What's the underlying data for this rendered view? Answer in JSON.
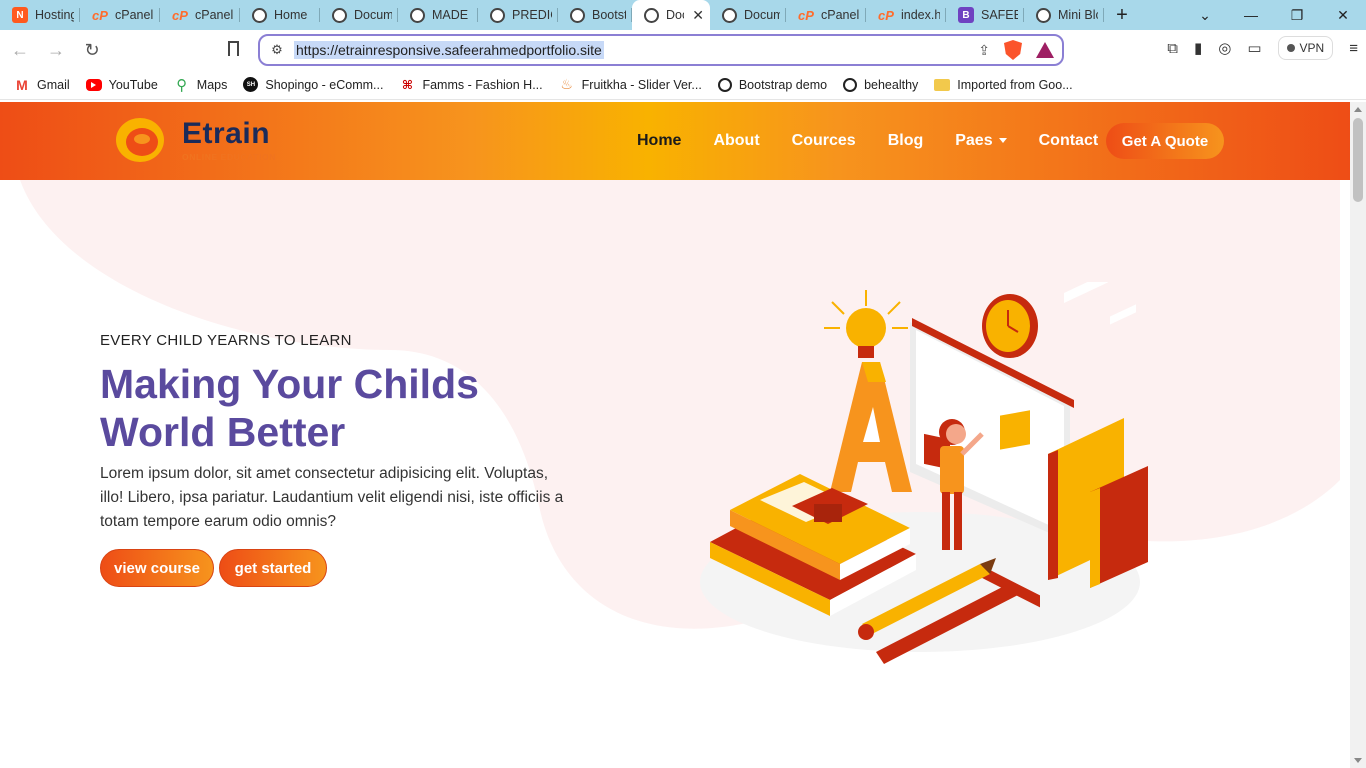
{
  "tabs": [
    {
      "title": "Hosting",
      "icon": "hosting-icon"
    },
    {
      "title": "cPanel -",
      "icon": "cpanel-icon"
    },
    {
      "title": "cPanel -",
      "icon": "cpanel-icon"
    },
    {
      "title": "Home",
      "icon": "globe-icon"
    },
    {
      "title": "Docume",
      "icon": "globe-icon"
    },
    {
      "title": "MADE B",
      "icon": "globe-icon"
    },
    {
      "title": "PREDIC",
      "icon": "globe-icon"
    },
    {
      "title": "Bootstra",
      "icon": "globe-icon"
    },
    {
      "title": "Doc",
      "icon": "globe-icon",
      "active": true
    },
    {
      "title": "Docume",
      "icon": "globe-icon"
    },
    {
      "title": "cPanel F",
      "icon": "cpanel-icon"
    },
    {
      "title": "index.ht",
      "icon": "cpanel-icon"
    },
    {
      "title": "SAFEER",
      "icon": "bootstrap-icon"
    },
    {
      "title": "Mini Blc",
      "icon": "globe-icon"
    }
  ],
  "address": {
    "url": "https://etrainresponsive.safeerahmedportfolio.site"
  },
  "toolbar": {
    "vpn_label": "VPN"
  },
  "bookmarks": [
    {
      "label": "Gmail",
      "icon": "gmail-icon"
    },
    {
      "label": "YouTube",
      "icon": "youtube-icon"
    },
    {
      "label": "Maps",
      "icon": "maps-icon"
    },
    {
      "label": "Shopingo - eComm...",
      "icon": "sh-icon"
    },
    {
      "label": "Famms - Fashion H...",
      "icon": "famms-icon"
    },
    {
      "label": "Fruitkha - Slider Ver...",
      "icon": "fruitkha-icon"
    },
    {
      "label": "Bootstrap demo",
      "icon": "globe-icon"
    },
    {
      "label": "behealthy",
      "icon": "globe-icon"
    },
    {
      "label": "Imported from Goo...",
      "icon": "folder-icon"
    }
  ],
  "site": {
    "brand": "Etrain",
    "tagline": "ONLINE EDUCATION",
    "nav": [
      {
        "label": "Home",
        "active": true
      },
      {
        "label": "About"
      },
      {
        "label": "Cources"
      },
      {
        "label": "Blog"
      },
      {
        "label": "Paes",
        "dropdown": true
      },
      {
        "label": "Contact"
      }
    ],
    "quote_button": "Get A Quote",
    "hero": {
      "subtitle": "EVERY CHILD YEARNS TO LEARN",
      "title": "Making Your Childs World Better",
      "text": "Lorem ipsum dolor, sit amet consectetur adipisicing elit. Voluptas, illo! Libero, ipsa pariatur. Laudantium velit eligendi nisi, iste officiis a totam tempore earum odio omnis?",
      "btn_view": "view course",
      "btn_start": "get started"
    }
  },
  "colors": {
    "accent_orange": "#ee4d16",
    "accent_yellow": "#f9b200",
    "title_purple": "#5a4a9e",
    "brand_navy": "#1b2b5a"
  }
}
